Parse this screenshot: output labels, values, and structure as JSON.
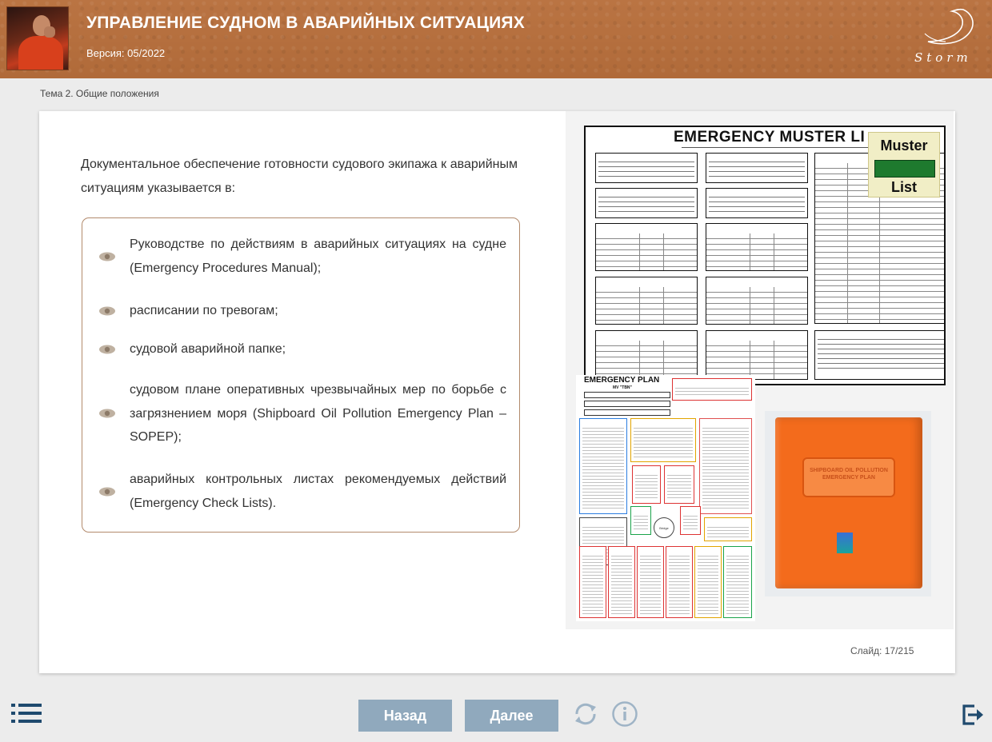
{
  "header": {
    "title": "УПРАВЛЕНИЕ СУДНОМ В АВАРИЙНЫХ СИТУАЦИЯХ",
    "version": "Версия: 05/2022",
    "logo_text": "Storm"
  },
  "topic": "Тема 2. Общие положения",
  "slide": {
    "intro": "Документальное обеспечение готовности судового экипажа к аварийным ситуациям указывается в:",
    "items": [
      "Руководстве по действиям в аварийных ситуациях на судне (Emergency Procedures Manual);",
      "расписании по тревогам;",
      "судовой аварийной папке;",
      "судовом плане оперативных чрезвычайных мер по борьбе с загрязнением моря (Shipboard Oil Pollution Emergency Plan – SOPEP);",
      "аварийных контрольных листах рекомендуемых действий (Emergency Check Lists)."
    ],
    "slide_counter": "Слайд: 17/215",
    "image": {
      "muster_title": "EMERGENCY MUSTER LI",
      "muster_tag_top": "Muster",
      "muster_tag_bottom": "List",
      "plan_title": "EMERGENCY PLAN",
      "plan_vessel": "MV \"TBN\"",
      "binder_text": "SHIPBOARD OIL POLLUTION EMERGENCY PLAN"
    }
  },
  "footer": {
    "back_label": "Назад",
    "next_label": "Далее"
  },
  "colors": {
    "header_bg": "#b5703f",
    "button_bg": "#90a9bd",
    "icon_color": "#1f4a6e",
    "list_border": "#b28a6c"
  },
  "icons": {
    "menu": "list-menu-icon",
    "reload": "reload-icon",
    "info": "info-icon",
    "exit": "exit-icon",
    "bullet": "eye-icon"
  }
}
